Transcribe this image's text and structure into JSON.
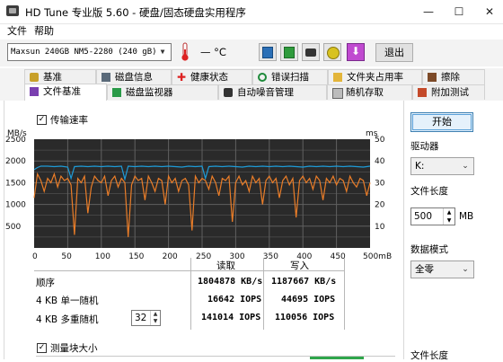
{
  "window": {
    "title": "HD Tune 专业版 5.60 - 硬盘/固态硬盘实用程序",
    "min": "—",
    "max": "☐",
    "close": "✕"
  },
  "menu": [
    "文件",
    "帮助"
  ],
  "toolbar": {
    "drive": "Maxsun  240GB NM5-2280 (240 gB)",
    "temperature": "— °C",
    "exit_label": "退出"
  },
  "tabs_top": [
    "基准",
    "磁盘信息",
    "健康状态",
    "错误扫描",
    "文件夹占用率",
    "擦除"
  ],
  "tabs_bottom": [
    "文件基准",
    "磁盘监视器",
    "自动噪音管理",
    "随机存取",
    "附加测试"
  ],
  "transfer": {
    "checkbox_label": "传输速率",
    "checked": true,
    "left_unit": "MB/s",
    "right_unit": "ms"
  },
  "results": {
    "col_read": "读取",
    "col_write": "写入",
    "rows": [
      {
        "label": "顺序",
        "read": "1804878 KB/s",
        "write": "1187667 KB/s"
      },
      {
        "label": "4 KB 单一随机",
        "read": "16642 IOPS",
        "write": "44695 IOPS"
      },
      {
        "label": "4 KB 多重随机",
        "read": "141014 IOPS",
        "write": "110056 IOPS"
      }
    ],
    "queue_depth": "32"
  },
  "block": {
    "checkbox_label": "测量块大小",
    "checked": true
  },
  "side": {
    "start_label": "开始",
    "drive_label": "驱动器",
    "drive_value": "K:",
    "file_length_label": "文件长度",
    "file_length_value": "500",
    "file_length_unit": "MB",
    "pattern_label": "数据模式",
    "pattern_value": "全零",
    "file_length_label2": "文件长度"
  },
  "colors": {
    "plot_bg": "#2a2a2a",
    "grid": "#606060",
    "read_line": "#1e9bd7",
    "write_line": "#ea7d28",
    "accent": "#0078d7"
  },
  "chart_data": {
    "type": "line",
    "x_unit": "mB",
    "x_ticks": [
      "0",
      "50",
      "100",
      "150",
      "200",
      "250",
      "300",
      "350",
      "400",
      "450",
      "500mB"
    ],
    "y_left": {
      "unit": "MB/s",
      "ticks": [
        "2500",
        "2000",
        "1500",
        "1000",
        "500"
      ],
      "ylim": [
        0,
        2500
      ]
    },
    "y_right": {
      "unit": "ms",
      "ticks": [
        "50",
        "40",
        "30",
        "20",
        "10"
      ],
      "ylim": [
        0,
        50
      ]
    },
    "grid": true,
    "series": [
      {
        "name": "读取",
        "color": "#1e9bd7",
        "x": [
          0,
          5,
          10,
          20,
          30,
          40,
          50,
          55,
          60,
          70,
          80,
          90,
          100,
          110,
          120,
          130,
          135,
          140,
          150,
          160,
          170,
          180,
          190,
          200,
          210,
          220,
          230,
          240,
          250,
          255,
          260,
          270,
          280,
          290,
          300,
          310,
          320,
          330,
          340,
          350,
          360,
          370,
          380,
          390,
          400,
          410,
          420,
          430,
          440,
          450,
          460,
          470,
          480,
          490,
          500
        ],
        "values": [
          1800,
          1850,
          1880,
          1880,
          1870,
          1880,
          1860,
          1600,
          1870,
          1880,
          1870,
          1880,
          1870,
          1880,
          1870,
          1880,
          1580,
          1880,
          1870,
          1880,
          1870,
          1880,
          1870,
          1880,
          1870,
          1860,
          1880,
          1870,
          1880,
          1600,
          1870,
          1880,
          1870,
          1880,
          1870,
          1860,
          1880,
          1870,
          1880,
          1870,
          1880,
          1870,
          1880,
          1870,
          1860,
          1880,
          1870,
          1880,
          1870,
          1880,
          1870,
          1880,
          1870,
          1860,
          1880
        ]
      },
      {
        "name": "写入",
        "color": "#ea7d28",
        "x": [
          0,
          5,
          10,
          15,
          20,
          25,
          30,
          35,
          40,
          45,
          50,
          55,
          60,
          65,
          70,
          75,
          80,
          85,
          90,
          95,
          100,
          105,
          110,
          115,
          120,
          125,
          130,
          135,
          140,
          145,
          150,
          155,
          160,
          165,
          170,
          175,
          180,
          185,
          190,
          195,
          200,
          205,
          210,
          215,
          220,
          225,
          230,
          235,
          240,
          245,
          250,
          255,
          260,
          265,
          270,
          275,
          280,
          285,
          290,
          295,
          300,
          305,
          310,
          315,
          320,
          325,
          330,
          335,
          340,
          345,
          350,
          355,
          360,
          365,
          370,
          375,
          380,
          385,
          390,
          395,
          400,
          405,
          410,
          415,
          420,
          425,
          430,
          435,
          440,
          445,
          450,
          455,
          460,
          465,
          470,
          475,
          480,
          485,
          490,
          495,
          500
        ],
        "values": [
          1150,
          1700,
          1550,
          1300,
          1600,
          1500,
          1700,
          1400,
          1650,
          1550,
          1600,
          1450,
          300,
          1600,
          1500,
          1650,
          800,
          1400,
          1650,
          1550,
          1500,
          1650,
          1200,
          1550,
          1650,
          1400,
          1600,
          1500,
          250,
          1450,
          1650,
          1550,
          1600,
          1100,
          1650,
          1500,
          1300,
          1600,
          1550,
          1000,
          1650,
          1500,
          1600,
          1300,
          1550,
          1600,
          1450,
          400,
          1650,
          1500,
          1600,
          1550,
          1350,
          1650,
          1500,
          1200,
          1600,
          1550,
          1650,
          600,
          1500,
          1650,
          1450,
          1550,
          1300,
          1650,
          1500,
          1600,
          1000,
          1550,
          1650,
          1500,
          1600,
          1150,
          1550,
          1650,
          1450,
          1600,
          700,
          1550,
          1650,
          1500,
          1600,
          1350,
          1650,
          1550,
          1100,
          1600,
          1500,
          1650,
          1450,
          1600,
          1550,
          1300,
          1650,
          1500,
          1400,
          1600,
          1550,
          1200,
          1500
        ]
      }
    ]
  }
}
